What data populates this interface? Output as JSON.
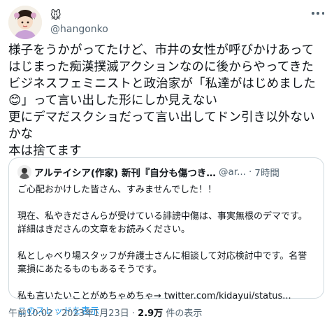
{
  "author": {
    "display_name": "",
    "name_emoji": "🐭",
    "handle": "@hangonko"
  },
  "tweet": {
    "text": "様子をうかがってたけど、市井の女性が呼びかけあってはじまった痴漢撲滅アクションなのに後からやってきたビジネスフェミニストと政治家が「私達がはじめました😊」って言い出した形にしか見えない\n更にデマだスクショだって言い出してドン引き以外ないかな\n本は捨てます"
  },
  "quoted_tweet": {
    "display_name": "アルテイシア(作家) 新刊『自分も傷つきたくないけど、他人...",
    "handle": "@ar...",
    "separator": "·",
    "time": "7時間",
    "body": "ご心配おかけした皆さん、すみませんでした！！\n\n現在、私やきださんらが受けている誹謗中傷は、事実無根のデマです。詳細はきださんの文章をお読みください。\n\n私としゃべり場スタッフが弁護士さんに相談して対応検討中です。名誉棄損にあたるものもあるそうです。\n\n私も言いたいことがめちゃめちゃ→ twitter.com/kidayui/status...",
    "thread_link": "このスレッドを表示"
  },
  "meta": {
    "timestamp": "午前10:02 · 2023年1月23日 · ",
    "views_count": "2.9万",
    "views_label": " 件の表示"
  },
  "icons": {
    "more": "more-icon",
    "avatar": "avatar-image",
    "quoted_avatar": "quoted-avatar-image"
  }
}
